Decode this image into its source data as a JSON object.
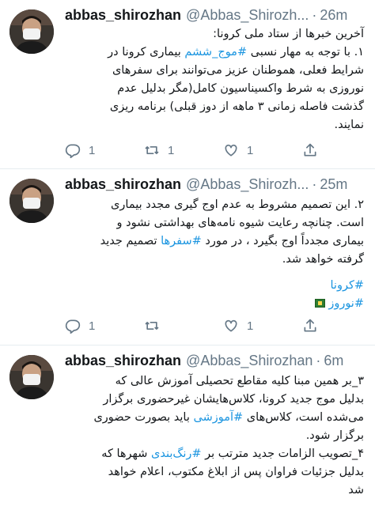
{
  "tweets": [
    {
      "name": "abbas_shirozhan",
      "handle": "@Abbas_Shirozh...",
      "dot": "·",
      "time": "26m",
      "lines": [
        "آخرین خبرها از ستاد ملی کرونا:",
        "۱. با توجه به مهار نسبی ",
        "شرایط فعلی، هموطنان عزیز می‌توانند برای سفرهای",
        "نوروزی به شرط واکسیناسیون کامل(مگر بدلیل عدم",
        "گذشت فاصله زمانی ۳ ماهه از دوز قبلی) برنامه ریزی",
        "نمایند."
      ],
      "hashtag1": "#موج_ششم",
      "line2_tail": " بیماری کرونا در",
      "replies": "1",
      "retweets": "1",
      "likes": "1"
    },
    {
      "name": "abbas_shirozhan",
      "handle": "@Abbas_Shirozh...",
      "dot": "·",
      "time": "25m",
      "line1": "۲. این تصمیم مشروط به عدم اوج گیری مجدد بیماری",
      "line2": "است. چنانچه رعایت شیوه نامه‌های بهداشتی نشود و",
      "line3_head": "بیماری مجدداً اوج بگیرد ، در مورد ",
      "line3_tag": "#سفرها",
      "line3_tail": " تصمیم جدید",
      "line4": "گرفته خواهد شد.",
      "tag_a": "#کرونا",
      "tag_b": "#نوروز",
      "replies": "1",
      "retweets": "",
      "likes": "1"
    },
    {
      "name": "abbas_shirozhan",
      "handle": "@Abbas_Shirozhan",
      "dot": "·",
      "time": "6m",
      "line1": "۳_بر همین مبنا کلیه مقاطع تحصیلی آموزش عالی که",
      "line2": "بدلیل موج جدید کرونا، کلاس‌هایشان غیرحضوری برگزار",
      "line3_head": "می‌شده است، کلاس‌های ",
      "line3_tag": "#آموزشی",
      "line3_tail": " باید بصورت حضوری",
      "line4": "برگزار شود.",
      "line5_head": "۴_تصویب الزامات جدید مترتب بر ",
      "line5_tag": "#رنگ‌بندی",
      "line5_tail": " شهرها که",
      "line6": "بدلیل جزئیات فراوان پس از ابلاغ مکتوب، اعلام خواهد",
      "line7": "شد"
    }
  ],
  "colors": {
    "link": "#1b95e0",
    "muted": "#657786",
    "text": "#14171a",
    "divider": "#e6ecf0"
  }
}
